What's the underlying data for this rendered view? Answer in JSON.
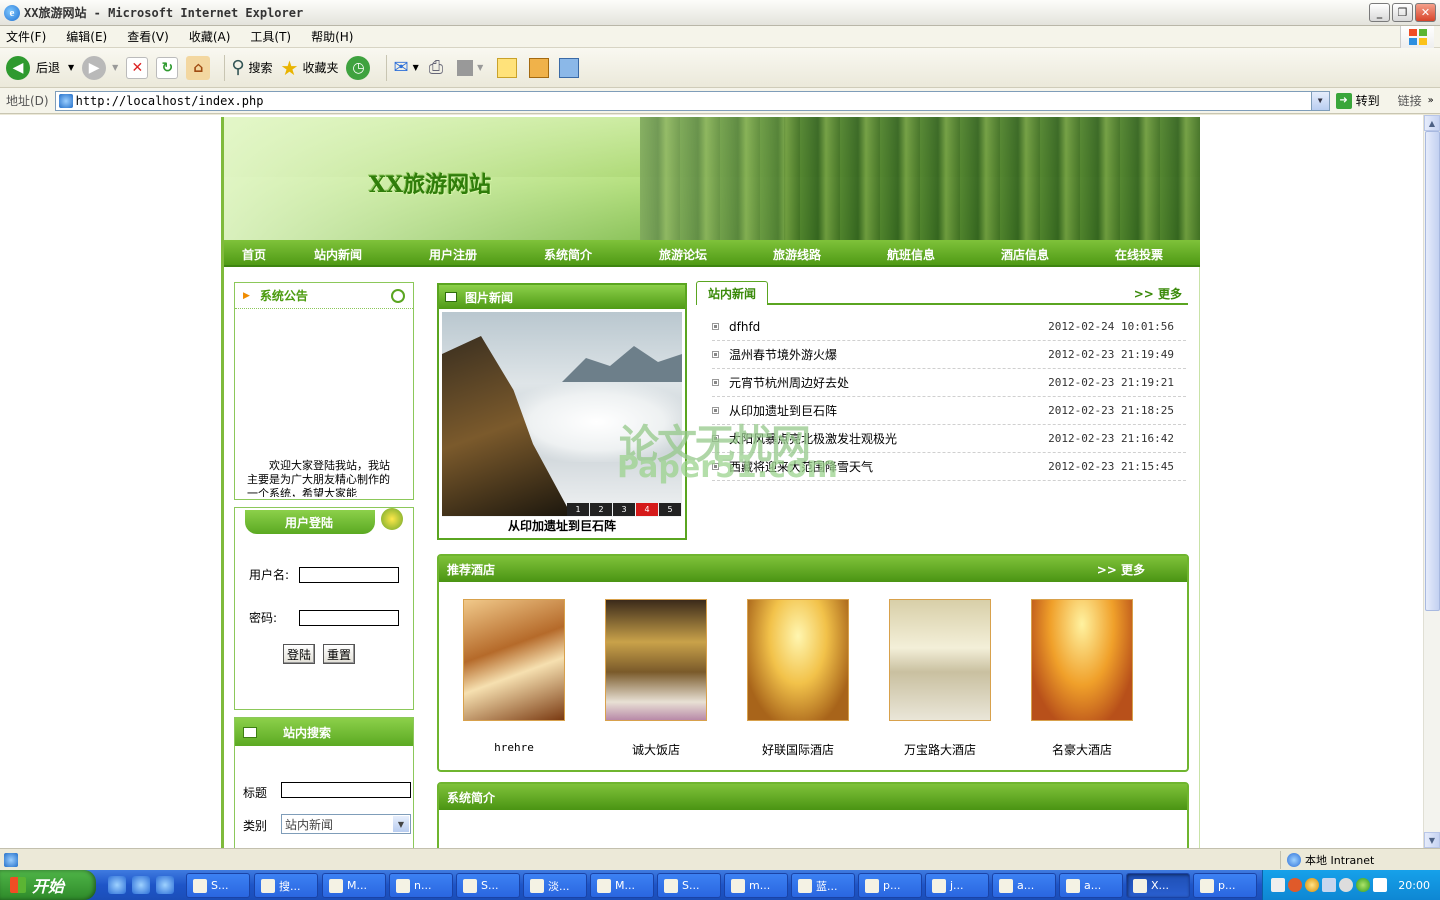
{
  "window": {
    "title": "XX旅游网站 - Microsoft Internet Explorer",
    "minimize_label": "_",
    "restore_label": "❐",
    "close_label": "✕"
  },
  "menu": [
    "文件(F)",
    "编辑(E)",
    "查看(V)",
    "收藏(A)",
    "工具(T)",
    "帮助(H)"
  ],
  "toolbar": {
    "back_label": "后退",
    "search_label": "搜索",
    "favorites_label": "收藏夹"
  },
  "address": {
    "label": "地址(D)",
    "url": "http://localhost/index.php",
    "go_label": "转到",
    "links_label": "链接"
  },
  "site": {
    "name": "XX旅游网站",
    "nav": [
      "首页",
      "站内新闻",
      "用户注册",
      "系统简介",
      "旅游论坛",
      "旅游线路",
      "航班信息",
      "酒店信息",
      "在线投票"
    ]
  },
  "notice": {
    "title": "系统公告",
    "body": "欢迎大家登陆我站，我站主要是为广大朋友精心制作的一个系统，希望大家能"
  },
  "login": {
    "title": "用户登陆",
    "username_label": "用户名:",
    "password_label": "密码:",
    "login_button": "登陆",
    "reset_button": "重置"
  },
  "search": {
    "title": "站内搜索",
    "title_label": "标题",
    "category_label": "类别",
    "category_value": "站内新闻"
  },
  "picnews": {
    "title": "图片新闻",
    "caption": "从印加遗址到巨石阵",
    "pages": [
      "1",
      "2",
      "3",
      "4",
      "5"
    ],
    "active_page": "4"
  },
  "sitenews": {
    "tab": "站内新闻",
    "more": ">> 更多",
    "items": [
      {
        "title": "dfhfd",
        "time": "2012-02-24 10:01:56"
      },
      {
        "title": "温州春节境外游火爆",
        "time": "2012-02-23 21:19:49"
      },
      {
        "title": "元宵节杭州周边好去处",
        "time": "2012-02-23 21:19:21"
      },
      {
        "title": "从印加遗址到巨石阵",
        "time": "2012-02-23 21:18:25"
      },
      {
        "title": "太阳风暴点亮北极激发壮观极光",
        "time": "2012-02-23 21:16:42"
      },
      {
        "title": "西藏将迎来大范围降雪天气",
        "time": "2012-02-23 21:15:45"
      }
    ]
  },
  "watermark": {
    "line1": "论文无忧网",
    "line2": "Paper51.com"
  },
  "hotels": {
    "title": "推荐酒店",
    "more": ">> 更多",
    "items": [
      {
        "name": "hrehre"
      },
      {
        "name": "诚大饭店"
      },
      {
        "name": "好联国际酒店"
      },
      {
        "name": "万宝路大酒店"
      },
      {
        "name": "名豪大酒店"
      }
    ]
  },
  "intro": {
    "title": "系统简介"
  },
  "status": {
    "zone": "本地 Intranet"
  },
  "taskbar": {
    "start": "开始",
    "tasks": [
      "S...",
      "搜...",
      "M...",
      "n...",
      "S...",
      "淡...",
      "M...",
      "S...",
      "m...",
      "蓝...",
      "p...",
      "j...",
      "a...",
      "a...",
      "X...",
      "p..."
    ],
    "active_task": 14,
    "clock": "20:00"
  },
  "colors": {
    "brand_green": "#5aa520",
    "nav_green": "#4f9a15",
    "link_green": "#3a8a0a"
  }
}
